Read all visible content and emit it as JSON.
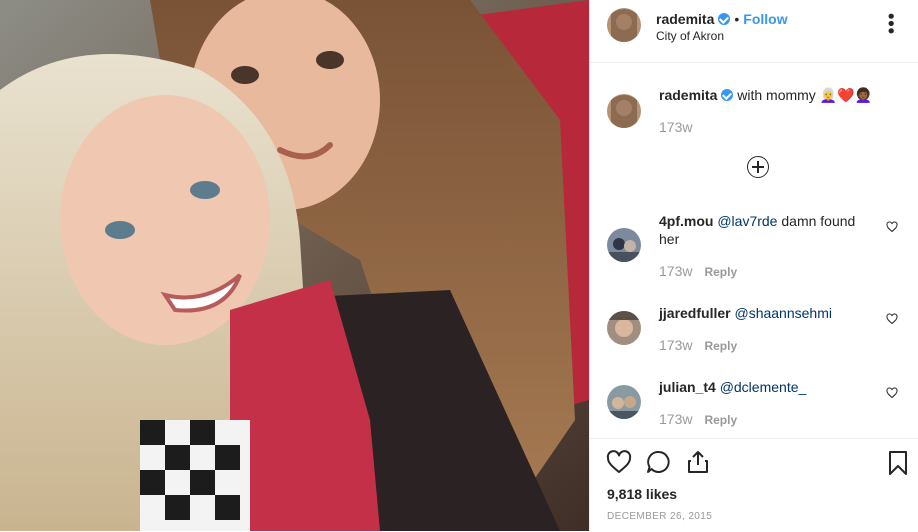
{
  "post": {
    "username": "rademita",
    "follow_label": "Follow",
    "dot": "•",
    "location": "City of Akron",
    "more_label": "•••",
    "caption": {
      "username": "rademita",
      "text": "with mommy",
      "emojis": "👩‍🦳❤️👩🏾‍🦱",
      "time": "173w"
    }
  },
  "comments": [
    {
      "username": "4pf.mou",
      "mention": "@lav7rde",
      "text": " damn found her",
      "time": "173w",
      "reply_label": "Reply"
    },
    {
      "username": "jjaredfuller",
      "mention": "@shaannsehmi",
      "text": "",
      "time": "173w",
      "reply_label": "Reply"
    },
    {
      "username": "julian_t4",
      "mention": "@dclemente_",
      "text": "",
      "time": "173w",
      "reply_label": "Reply"
    }
  ],
  "actions": {
    "likes": "9,818 likes",
    "date": "DECEMBER 26, 2015"
  },
  "icons": [
    "verified-badge-icon",
    "more-options-icon",
    "load-more-comments-icon",
    "like-icon",
    "comment-icon",
    "share-icon",
    "save-bookmark-icon"
  ],
  "colors": {
    "link_blue": "#3897f0",
    "text": "#262626",
    "muted": "#999999",
    "mention": "#003569",
    "border": "#efefef"
  }
}
